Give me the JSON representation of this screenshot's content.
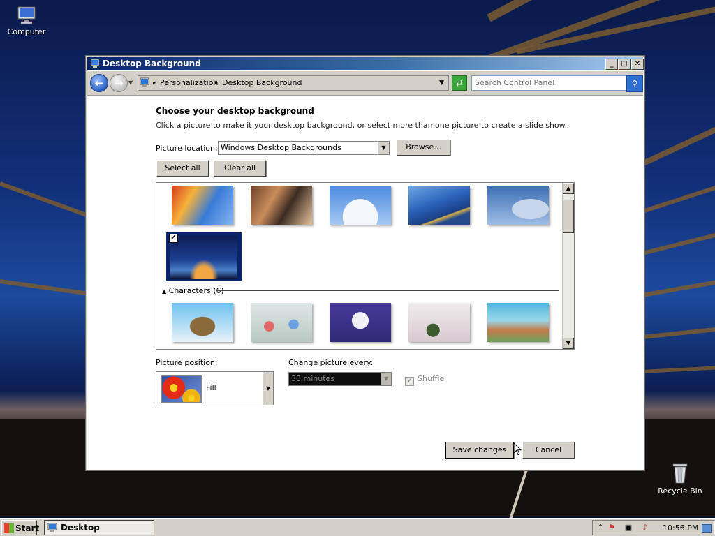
{
  "desktop": {
    "icons": [
      {
        "label": "Computer"
      },
      {
        "label": "Recycle Bin"
      }
    ]
  },
  "window": {
    "title": "Desktop Background",
    "controls": {
      "minimize": "_",
      "maximize": "□",
      "close": "✕"
    },
    "address": {
      "crumbs": [
        "Personalization",
        "Desktop Background"
      ]
    },
    "search": {
      "placeholder": "Search Control Panel"
    },
    "heading": "Choose your desktop background",
    "description": "Click a picture to make it your desktop background, or select more than one picture to create a slide show.",
    "picture_location": {
      "label": "Picture location:",
      "value": "Windows Desktop Backgrounds",
      "browse": "Browse..."
    },
    "select_all": "Select all",
    "clear_all": "Clear all",
    "gallery": {
      "group_label": "Characters (6)"
    },
    "picture_position": {
      "label": "Picture position:",
      "value": "Fill"
    },
    "change_every": {
      "label": "Change picture every:",
      "value": "30 minutes"
    },
    "shuffle": {
      "label": "Shuffle",
      "checked": true,
      "enabled": false
    },
    "save": "Save changes",
    "cancel": "Cancel"
  },
  "taskbar": {
    "start": "Start",
    "task": "Desktop Background",
    "clock": "10:56 PM"
  }
}
